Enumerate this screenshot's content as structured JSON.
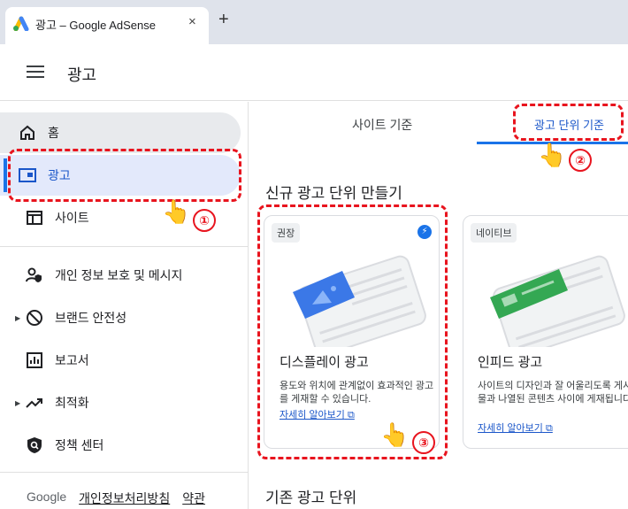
{
  "browser": {
    "tab_title": "광고 – Google AdSense",
    "close_glyph": "×",
    "new_tab_glyph": "+"
  },
  "header": {
    "title": "광고"
  },
  "sidebar": {
    "items": [
      {
        "label": "홈",
        "icon": "home-icon"
      },
      {
        "label": "광고",
        "icon": "ads-icon",
        "active": true
      },
      {
        "label": "사이트",
        "icon": "sites-icon"
      },
      {
        "label": "개인 정보 보호 및 메시지",
        "icon": "privacy-icon"
      },
      {
        "label": "브랜드 안전성",
        "icon": "block-icon"
      },
      {
        "label": "보고서",
        "icon": "reports-icon"
      },
      {
        "label": "최적화",
        "icon": "trending-icon"
      },
      {
        "label": "정책 센터",
        "icon": "policy-icon"
      }
    ],
    "footer": {
      "brand": "Google",
      "privacy": "개인정보처리방침",
      "terms": "약관"
    }
  },
  "main": {
    "tabs": [
      {
        "label": "사이트 기준"
      },
      {
        "label": "광고 단위 기준",
        "active": true
      }
    ],
    "section_title": "신규 광고 단위 만들기",
    "existing_title": "기존 광고 단위",
    "cards": [
      {
        "badge": "권장",
        "title": "디스플레이 광고",
        "description": "용도와 위치에 관계없이 효과적인 광고를 게재할 수 있습니다.",
        "link": "자세히 알아보기"
      },
      {
        "badge": "네이티브",
        "title": "인피드 광고",
        "description": "사이트의 디자인과 잘 어울리도록 게시물과 나열된 콘텐츠 사이에 게재됩니다.",
        "link": "자세히 알아보기"
      }
    ]
  },
  "annotations": {
    "marker1": "①",
    "marker2": "②",
    "marker3": "③",
    "hand": "👆"
  },
  "colors": {
    "accent": "#1a73e8",
    "annotation": "#e8141e",
    "active_bg": "#e3e9fb"
  }
}
